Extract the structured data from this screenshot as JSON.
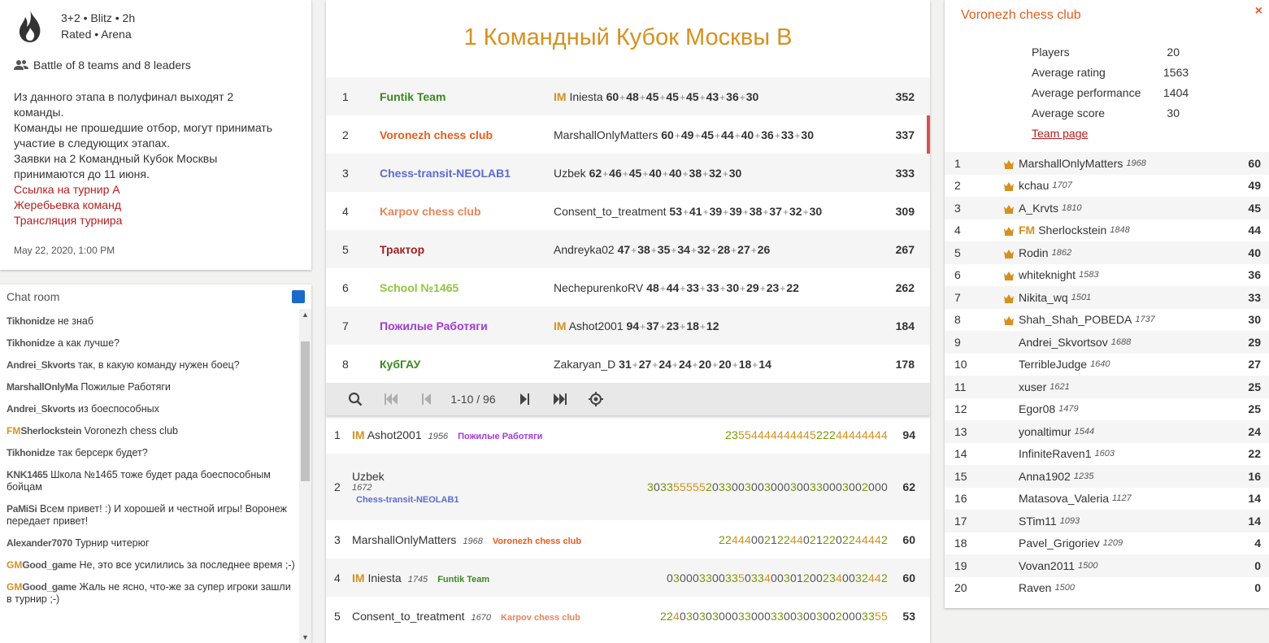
{
  "info": {
    "setup_line1": "3+2 • Blitz • 2h",
    "setup_line2": "Rated • Arena",
    "battle": "Battle of 8 teams and 8 leaders",
    "desc_lines": [
      "Из данного этапа в полуфинал выходят 2",
      "команды.",
      "Команды не прошедшие отбор, могут принимать",
      "участие в следующих этапах.",
      "Заявки на 2 Командный Кубок Москвы",
      "принимаются до 11 июня."
    ],
    "links": [
      "Ссылка на турнир А",
      "Жеребьевка команд",
      "Трансляция турнира"
    ],
    "date": "May 22, 2020, 1:00 PM"
  },
  "chat": {
    "title": "Chat room",
    "lines": [
      {
        "title": "",
        "user": "Tikhonidze",
        "text": "не знаб"
      },
      {
        "title": "",
        "user": "Tikhonidze",
        "text": "а как лучше?"
      },
      {
        "title": "",
        "user": "Andrei_Skvorts",
        "text": "так, в какую команду нужен боец?"
      },
      {
        "title": "",
        "user": "MarshallOnlyMa",
        "text": "Пожилые Работяги"
      },
      {
        "title": "",
        "user": "Andrei_Skvorts",
        "text": "из боеспособных"
      },
      {
        "title": "FM",
        "user": "Sherlockstein",
        "text": "Voronezh chess club"
      },
      {
        "title": "",
        "user": "Tikhonidze",
        "text": "так берсерк будет?"
      },
      {
        "title": "",
        "user": "KNK1465",
        "text": "Школа №1465 тоже будет рада боеспособным бойцам"
      },
      {
        "title": "",
        "user": "PaMiSi",
        "text": "Всем привет! :) И хорошей и честной игры! Воронеж передает привет!"
      },
      {
        "title": "",
        "user": "Alexander7070",
        "text": "Турнир читерюг"
      },
      {
        "title": "GM",
        "user": "Good_game",
        "text": "Не, это все усилились за последнее время ;-)"
      },
      {
        "title": "GM",
        "user": "Good_game",
        "text": "Жаль не ясно, что-же за супер игроки зашли в турнир ;-)"
      }
    ]
  },
  "center": {
    "title": "1 Командный Кубок Москвы B",
    "teams": [
      {
        "rank": "1",
        "name": "Funtik Team",
        "color": "#3a8a1f",
        "leader_title": "IM",
        "leader": "Iniesta",
        "points": [
          "60",
          "48",
          "45",
          "45",
          "45",
          "43",
          "36",
          "30"
        ],
        "score": "352"
      },
      {
        "rank": "2",
        "name": "Voronezh chess club",
        "color": "#e65c1b",
        "leader_title": "",
        "leader": "MarshallOnlyMatters",
        "points": [
          "60",
          "49",
          "45",
          "44",
          "40",
          "36",
          "33",
          "30"
        ],
        "score": "337"
      },
      {
        "rank": "3",
        "name": "Chess-transit-NEOLAB1",
        "color": "#5c6bd6",
        "leader_title": "",
        "leader": "Uzbek",
        "points": [
          "62",
          "46",
          "45",
          "40",
          "40",
          "38",
          "32",
          "30"
        ],
        "score": "333"
      },
      {
        "rank": "4",
        "name": "Karpov chess club",
        "color": "#e6855c",
        "leader_title": "",
        "leader": "Consent_to_treatment",
        "points": [
          "53",
          "41",
          "39",
          "39",
          "38",
          "37",
          "32",
          "30"
        ],
        "score": "309"
      },
      {
        "rank": "5",
        "name": "Трактор",
        "color": "#a32020",
        "leader_title": "",
        "leader": "Andreyka02",
        "points": [
          "47",
          "38",
          "35",
          "34",
          "32",
          "28",
          "27",
          "26"
        ],
        "score": "267"
      },
      {
        "rank": "6",
        "name": "School №1465",
        "color": "#8fc63e",
        "leader_title": "",
        "leader": "NechepurenkoRV",
        "points": [
          "48",
          "44",
          "33",
          "33",
          "30",
          "29",
          "23",
          "22"
        ],
        "score": "262"
      },
      {
        "rank": "7",
        "name": "Пожилые Работяги",
        "color": "#a33ad6",
        "leader_title": "IM",
        "leader": "Ashot2001",
        "points": [
          "94",
          "37",
          "23",
          "18",
          "12"
        ],
        "score": "184"
      },
      {
        "rank": "8",
        "name": "КубГАУ",
        "color": "#3a8a1f",
        "leader_title": "",
        "leader": "Zakaryan_D",
        "points": [
          "31",
          "27",
          "24",
          "24",
          "20",
          "20",
          "18",
          "14"
        ],
        "score": "178"
      }
    ],
    "pager": {
      "range": "1-10 / 96"
    },
    "players": [
      {
        "rank": "1",
        "title": "IM",
        "name": "Ashot2001",
        "rating": "1956",
        "team": "Пожилые Работяги",
        "team_color": "#a33ad6",
        "sheet": "2355444444444522244444444",
        "score": "94",
        "tall": false
      },
      {
        "rank": "2",
        "title": "",
        "name": "Uzbek",
        "rating": "1672",
        "team": "Chess-transit-NEOLAB1",
        "team_color": "#5c6bd6",
        "sheet": "3033555552033003003000300330003002000",
        "score": "62",
        "tall": true
      },
      {
        "rank": "3",
        "title": "",
        "name": "MarshallOnlyMatters",
        "rating": "1968",
        "team": "Voronezh chess club",
        "team_color": "#e65c1b",
        "sheet": "22444002122440212202244442",
        "score": "60",
        "tall": false
      },
      {
        "rank": "4",
        "title": "IM",
        "name": "Iniesta",
        "rating": "1745",
        "team": "Funtik Team",
        "team_color": "#3a8a1f",
        "sheet": "030003300335033400301200234003244 2",
        "score": "60",
        "tall": false
      },
      {
        "rank": "5",
        "title": "",
        "name": "Consent_to_treatment",
        "rating": "1670",
        "team": "Karpov chess club",
        "team_color": "#e6855c",
        "sheet": "22403030300033000330030030020003355",
        "score": "53",
        "tall": false
      }
    ]
  },
  "right": {
    "team_name": "Voronezh chess club",
    "close": "×",
    "stats": [
      {
        "label": "Players",
        "value": "20"
      },
      {
        "label": "Average rating",
        "value": "1563"
      },
      {
        "label": "Average performance",
        "value": "1404"
      },
      {
        "label": "Average score",
        "value": "30"
      }
    ],
    "team_page": "Team page",
    "members": [
      {
        "rank": "1",
        "crown": true,
        "title": "",
        "name": "MarshallOnlyMatters",
        "rating": "1968",
        "score": "60"
      },
      {
        "rank": "2",
        "crown": true,
        "title": "",
        "name": "kchau",
        "rating": "1707",
        "score": "49"
      },
      {
        "rank": "3",
        "crown": true,
        "title": "",
        "name": "A_Krvts",
        "rating": "1810",
        "score": "45"
      },
      {
        "rank": "4",
        "crown": true,
        "title": "FM",
        "name": "Sherlockstein",
        "rating": "1848",
        "score": "44"
      },
      {
        "rank": "5",
        "crown": true,
        "title": "",
        "name": "Rodin",
        "rating": "1862",
        "score": "40"
      },
      {
        "rank": "6",
        "crown": true,
        "title": "",
        "name": "whiteknight",
        "rating": "1583",
        "score": "36"
      },
      {
        "rank": "7",
        "crown": true,
        "title": "",
        "name": "Nikita_wq",
        "rating": "1501",
        "score": "33"
      },
      {
        "rank": "8",
        "crown": true,
        "title": "",
        "name": "Shah_Shah_POBEDA",
        "rating": "1737",
        "score": "30"
      },
      {
        "rank": "9",
        "crown": false,
        "title": "",
        "name": "Andrei_Skvortsov",
        "rating": "1688",
        "score": "29"
      },
      {
        "rank": "10",
        "crown": false,
        "title": "",
        "name": "TerribleJudge",
        "rating": "1640",
        "score": "27"
      },
      {
        "rank": "11",
        "crown": false,
        "title": "",
        "name": "xuser",
        "rating": "1621",
        "score": "25"
      },
      {
        "rank": "12",
        "crown": false,
        "title": "",
        "name": "Egor08",
        "rating": "1479",
        "score": "25"
      },
      {
        "rank": "13",
        "crown": false,
        "title": "",
        "name": "yonaltimur",
        "rating": "1544",
        "score": "24"
      },
      {
        "rank": "14",
        "crown": false,
        "title": "",
        "name": "InfiniteRaven1",
        "rating": "1603",
        "score": "22"
      },
      {
        "rank": "15",
        "crown": false,
        "title": "",
        "name": "Anna1902",
        "rating": "1235",
        "score": "16"
      },
      {
        "rank": "16",
        "crown": false,
        "title": "",
        "name": "Matasova_Valeria",
        "rating": "1127",
        "score": "14"
      },
      {
        "rank": "17",
        "crown": false,
        "title": "",
        "name": "STim11",
        "rating": "1093",
        "score": "14"
      },
      {
        "rank": "18",
        "crown": false,
        "title": "",
        "name": "Pavel_Grigoriev",
        "rating": "1209",
        "score": "4"
      },
      {
        "rank": "19",
        "crown": false,
        "title": "",
        "name": "Vovan2011",
        "rating": "1500",
        "score": "0"
      },
      {
        "rank": "20",
        "crown": false,
        "title": "",
        "name": "Raven",
        "rating": "1500",
        "score": "0"
      }
    ]
  }
}
